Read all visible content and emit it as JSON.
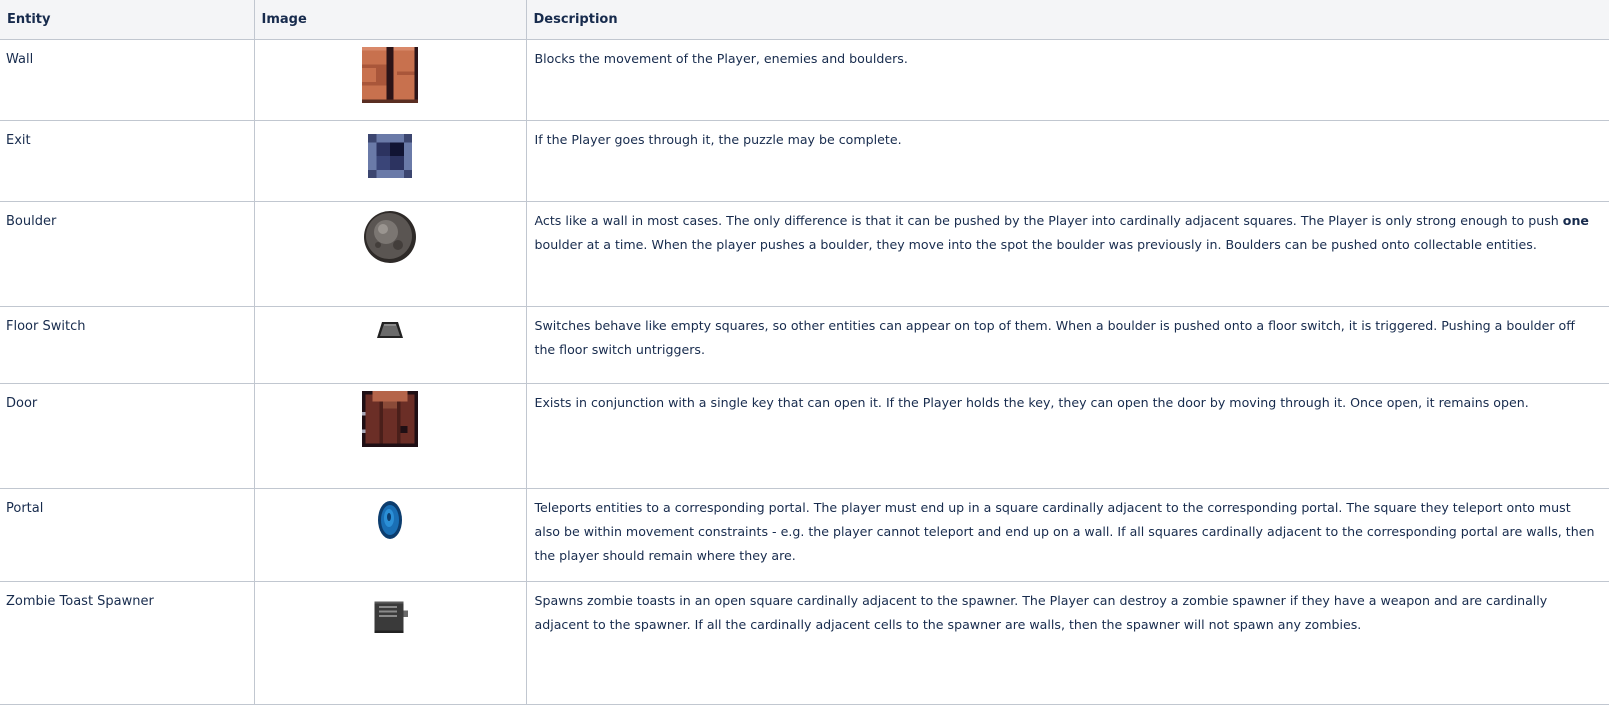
{
  "table": {
    "headers": {
      "entity": "Entity",
      "image": "Image",
      "description": "Description"
    },
    "rows": [
      {
        "entity": "Wall",
        "icon": "wall-icon",
        "description": "Blocks the movement of the Player, enemies and boulders."
      },
      {
        "entity": "Exit",
        "icon": "exit-icon",
        "description": "If the Player goes through it, the puzzle may be complete."
      },
      {
        "entity": "Boulder",
        "icon": "boulder-icon",
        "description_before": "Acts like a wall in most cases. The only difference is that it can be pushed by the Player into cardinally adjacent squares. The Player is only strong enough to push ",
        "description_bold": "one",
        "description_after": " boulder at a time. When the player pushes a boulder, they move into the spot the boulder was previously in. Boulders can be pushed onto collectable entities."
      },
      {
        "entity": "Floor Switch",
        "icon": "floor-switch-icon",
        "description": "Switches behave like empty squares, so other entities can appear on top of them. When a boulder is pushed onto a floor switch, it is triggered. Pushing a boulder off the floor switch untriggers."
      },
      {
        "entity": "Door",
        "icon": "door-icon",
        "description": "Exists in conjunction with a single key that can open it. If the Player holds the key, they can open the door by moving through it. Once open, it remains open."
      },
      {
        "entity": "Portal",
        "icon": "portal-icon",
        "description": "Teleports entities to a corresponding portal. The player must end up in a square cardinally adjacent to the corresponding portal. The square they teleport onto must also be within movement constraints - e.g. the player cannot teleport and end up on a wall. If all squares cardinally adjacent to the corresponding portal are walls, then the player should remain where they are."
      },
      {
        "entity": "Zombie Toast Spawner",
        "icon": "zombie-toast-spawner-icon",
        "description": "Spawns zombie toasts in an open square cardinally adjacent to the spawner. The Player can destroy a zombie spawner if they have a weapon and are cardinally adjacent to the spawner. If all the cardinally adjacent cells to the spawner are walls, then the spawner will not spawn any zombies."
      }
    ]
  }
}
